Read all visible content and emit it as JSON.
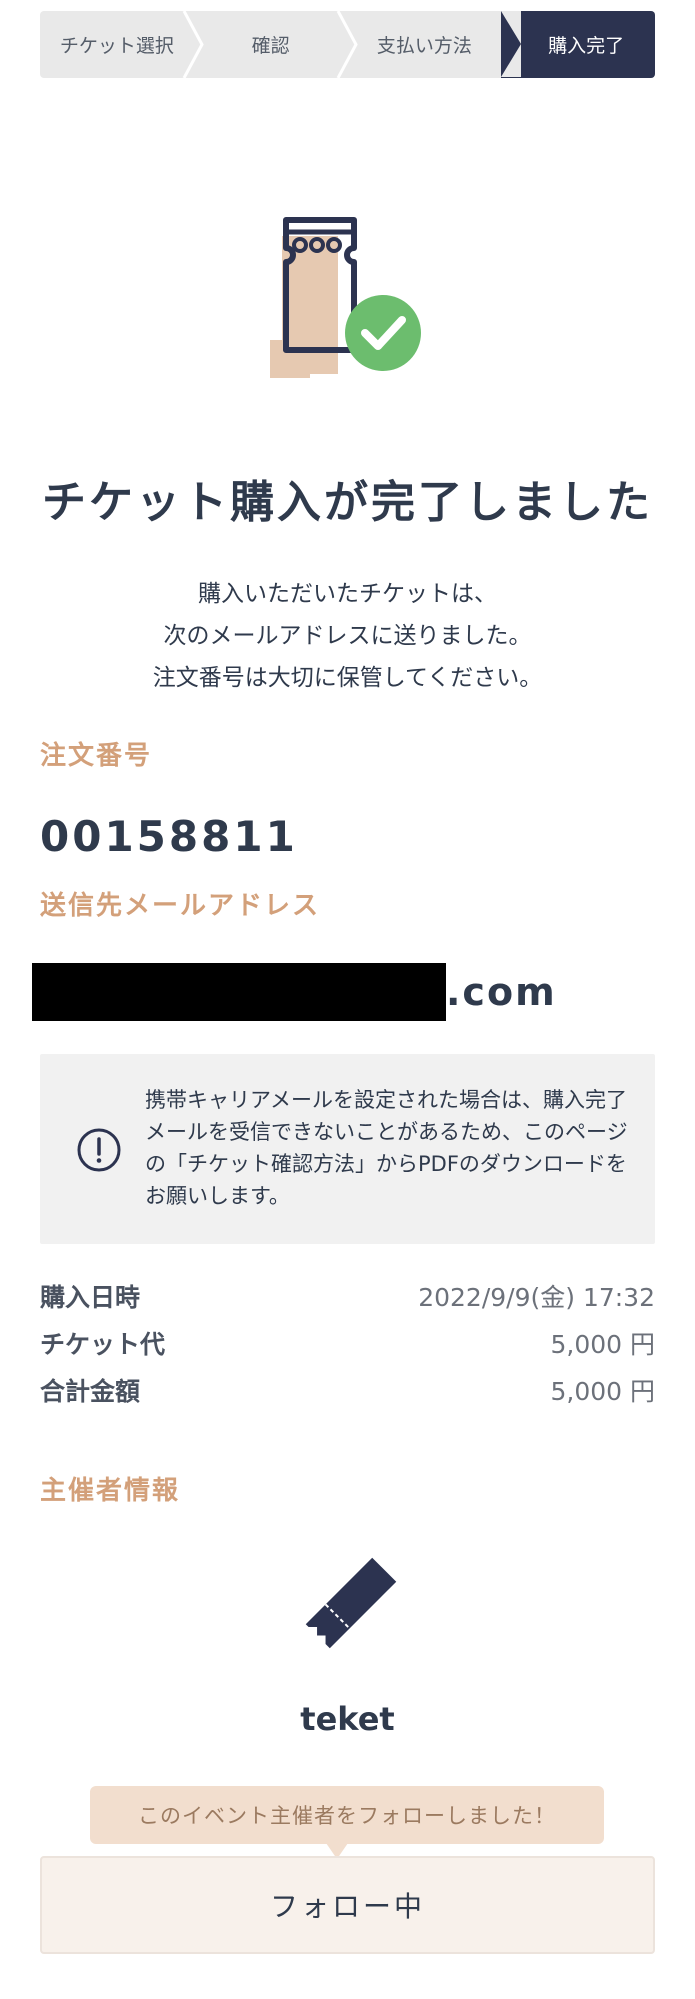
{
  "stepper": {
    "steps": [
      {
        "label": "チケット選択"
      },
      {
        "label": "確認"
      },
      {
        "label": "支払い方法"
      },
      {
        "label": "購入完了"
      }
    ],
    "active_index": 3
  },
  "title": "チケット購入が完了しました",
  "description": {
    "line1": "購入いただいたチケットは、",
    "line2": "次のメールアドレスに送りました。",
    "line3": "注文番号は大切に保管してください。"
  },
  "order": {
    "label": "注文番号",
    "number": "00158811"
  },
  "email": {
    "label": "送信先メールアドレス",
    "suffix": ".com"
  },
  "notice": {
    "icon": "exclamation-circle-icon",
    "text": "携帯キャリアメールを設定された場合は、購入完了メールを受信できないことがあるため、このページの「チケット確認方法」からPDFのダウンロードをお願いします。"
  },
  "summary": [
    {
      "key": "購入日時",
      "value": "2022/9/9(金) 17:32"
    },
    {
      "key": "チケット代",
      "value": "5,000 円"
    },
    {
      "key": "合計金額",
      "value": "5,000 円"
    }
  ],
  "organizer": {
    "label": "主催者情報",
    "logo_icon": "ticket-icon",
    "name": "teket"
  },
  "follow": {
    "tooltip": "このイベント主催者をフォローしました！",
    "button_label": "フォロー中"
  },
  "colors": {
    "navy": "#2c3350",
    "accent": "#d3a07a",
    "check_green": "#6cbd6e",
    "tooltip_bg": "#f2dece"
  }
}
